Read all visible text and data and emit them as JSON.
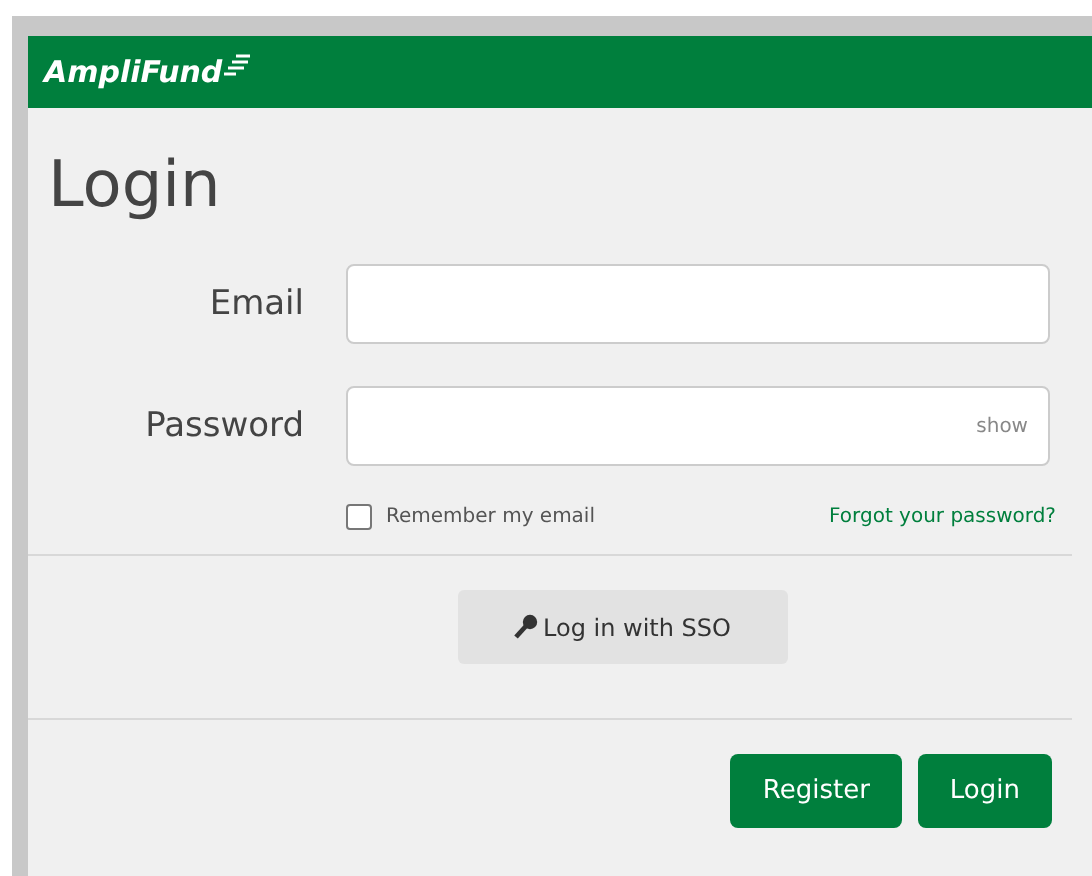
{
  "header": {
    "logo": "AmpliFund"
  },
  "title": "Login",
  "fields": [
    {
      "label": "Email"
    },
    {
      "label": "Password",
      "toggle": "show"
    }
  ],
  "remember": {
    "label": "Remember my email",
    "checked": false
  },
  "forgot_link": "Forgot your password?",
  "sso_button": "Log in with SSO",
  "buttons": [
    "Register",
    "Login"
  ]
}
